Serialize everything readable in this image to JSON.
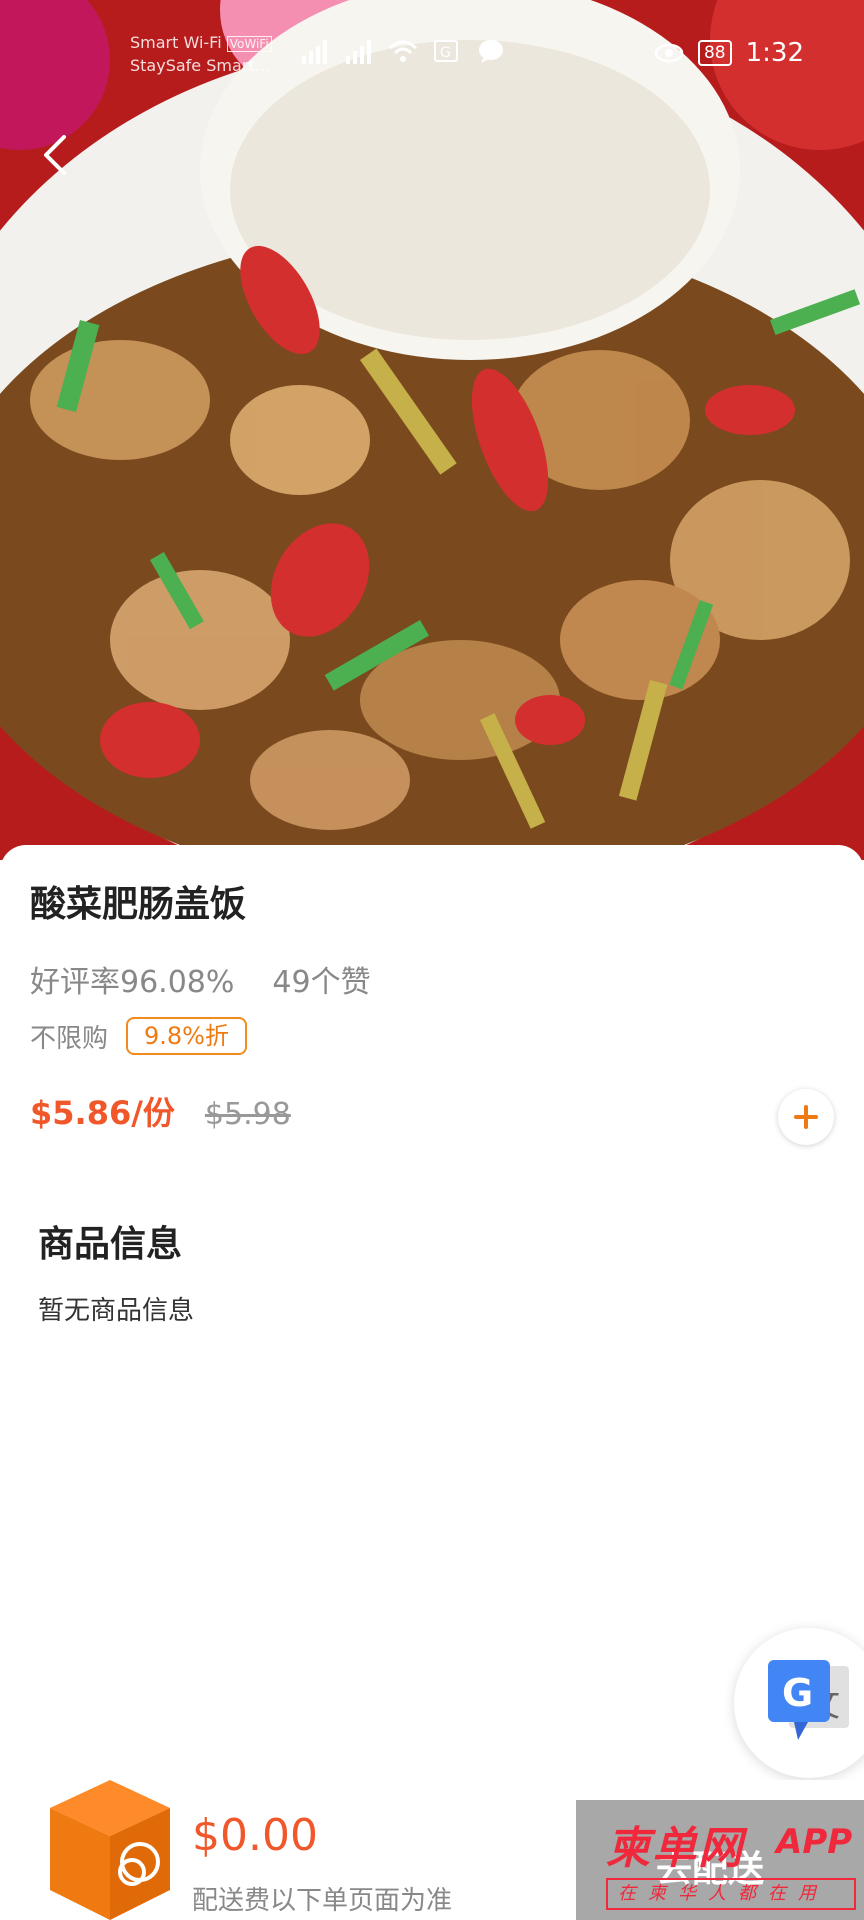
{
  "status_bar": {
    "carrier_line1": "Smart  Wi-Fi",
    "carrier_badge": "VoWiFi",
    "carrier_line2": "StaySafe Smart...",
    "battery": "88",
    "time": "1:32"
  },
  "product": {
    "name": "酸菜肥肠盖饭",
    "rating": "好评率96.08%",
    "likes": "49个赞",
    "limit": "不限购",
    "discount": "9.8%折",
    "price": "$5.86/份",
    "original_price": "$5.98"
  },
  "info": {
    "title": "商品信息",
    "body": "暂无商品信息"
  },
  "cart": {
    "total": "$0.00",
    "fee_note": "配送费以下单页面为准",
    "checkout_label": "去配送",
    "watermark_title": "柬单网",
    "watermark_app": "APP",
    "watermark_sub": "在柬华人都在用"
  },
  "icons": {
    "back": "chevron-left-icon",
    "add": "plus-icon",
    "translate": "google-translate-icon",
    "cart": "box-icon"
  },
  "colors": {
    "accent": "#f0572a",
    "discount": "#f07a12",
    "checkout_bg": "#a8a8a8"
  }
}
